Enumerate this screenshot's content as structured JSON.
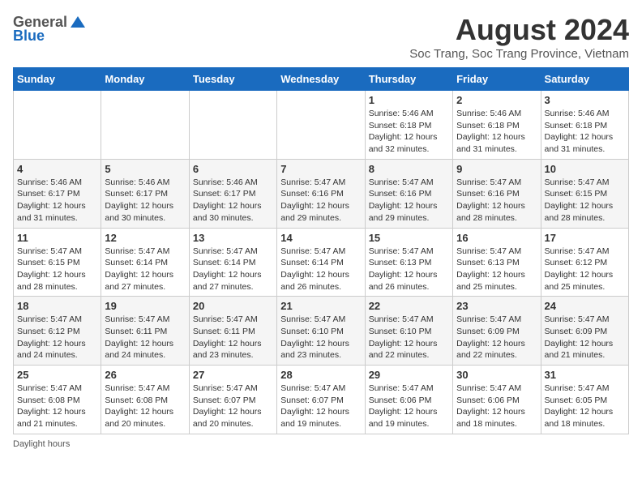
{
  "header": {
    "logo_general": "General",
    "logo_blue": "Blue",
    "title": "August 2024",
    "subtitle": "Soc Trang, Soc Trang Province, Vietnam"
  },
  "days_of_week": [
    "Sunday",
    "Monday",
    "Tuesday",
    "Wednesday",
    "Thursday",
    "Friday",
    "Saturday"
  ],
  "weeks": [
    [
      {
        "day": "",
        "info": ""
      },
      {
        "day": "",
        "info": ""
      },
      {
        "day": "",
        "info": ""
      },
      {
        "day": "",
        "info": ""
      },
      {
        "day": "1",
        "info": "Sunrise: 5:46 AM\nSunset: 6:18 PM\nDaylight: 12 hours and 32 minutes."
      },
      {
        "day": "2",
        "info": "Sunrise: 5:46 AM\nSunset: 6:18 PM\nDaylight: 12 hours and 31 minutes."
      },
      {
        "day": "3",
        "info": "Sunrise: 5:46 AM\nSunset: 6:18 PM\nDaylight: 12 hours and 31 minutes."
      }
    ],
    [
      {
        "day": "4",
        "info": "Sunrise: 5:46 AM\nSunset: 6:17 PM\nDaylight: 12 hours and 31 minutes."
      },
      {
        "day": "5",
        "info": "Sunrise: 5:46 AM\nSunset: 6:17 PM\nDaylight: 12 hours and 30 minutes."
      },
      {
        "day": "6",
        "info": "Sunrise: 5:46 AM\nSunset: 6:17 PM\nDaylight: 12 hours and 30 minutes."
      },
      {
        "day": "7",
        "info": "Sunrise: 5:47 AM\nSunset: 6:16 PM\nDaylight: 12 hours and 29 minutes."
      },
      {
        "day": "8",
        "info": "Sunrise: 5:47 AM\nSunset: 6:16 PM\nDaylight: 12 hours and 29 minutes."
      },
      {
        "day": "9",
        "info": "Sunrise: 5:47 AM\nSunset: 6:16 PM\nDaylight: 12 hours and 28 minutes."
      },
      {
        "day": "10",
        "info": "Sunrise: 5:47 AM\nSunset: 6:15 PM\nDaylight: 12 hours and 28 minutes."
      }
    ],
    [
      {
        "day": "11",
        "info": "Sunrise: 5:47 AM\nSunset: 6:15 PM\nDaylight: 12 hours and 28 minutes."
      },
      {
        "day": "12",
        "info": "Sunrise: 5:47 AM\nSunset: 6:14 PM\nDaylight: 12 hours and 27 minutes."
      },
      {
        "day": "13",
        "info": "Sunrise: 5:47 AM\nSunset: 6:14 PM\nDaylight: 12 hours and 27 minutes."
      },
      {
        "day": "14",
        "info": "Sunrise: 5:47 AM\nSunset: 6:14 PM\nDaylight: 12 hours and 26 minutes."
      },
      {
        "day": "15",
        "info": "Sunrise: 5:47 AM\nSunset: 6:13 PM\nDaylight: 12 hours and 26 minutes."
      },
      {
        "day": "16",
        "info": "Sunrise: 5:47 AM\nSunset: 6:13 PM\nDaylight: 12 hours and 25 minutes."
      },
      {
        "day": "17",
        "info": "Sunrise: 5:47 AM\nSunset: 6:12 PM\nDaylight: 12 hours and 25 minutes."
      }
    ],
    [
      {
        "day": "18",
        "info": "Sunrise: 5:47 AM\nSunset: 6:12 PM\nDaylight: 12 hours and 24 minutes."
      },
      {
        "day": "19",
        "info": "Sunrise: 5:47 AM\nSunset: 6:11 PM\nDaylight: 12 hours and 24 minutes."
      },
      {
        "day": "20",
        "info": "Sunrise: 5:47 AM\nSunset: 6:11 PM\nDaylight: 12 hours and 23 minutes."
      },
      {
        "day": "21",
        "info": "Sunrise: 5:47 AM\nSunset: 6:10 PM\nDaylight: 12 hours and 23 minutes."
      },
      {
        "day": "22",
        "info": "Sunrise: 5:47 AM\nSunset: 6:10 PM\nDaylight: 12 hours and 22 minutes."
      },
      {
        "day": "23",
        "info": "Sunrise: 5:47 AM\nSunset: 6:09 PM\nDaylight: 12 hours and 22 minutes."
      },
      {
        "day": "24",
        "info": "Sunrise: 5:47 AM\nSunset: 6:09 PM\nDaylight: 12 hours and 21 minutes."
      }
    ],
    [
      {
        "day": "25",
        "info": "Sunrise: 5:47 AM\nSunset: 6:08 PM\nDaylight: 12 hours and 21 minutes."
      },
      {
        "day": "26",
        "info": "Sunrise: 5:47 AM\nSunset: 6:08 PM\nDaylight: 12 hours and 20 minutes."
      },
      {
        "day": "27",
        "info": "Sunrise: 5:47 AM\nSunset: 6:07 PM\nDaylight: 12 hours and 20 minutes."
      },
      {
        "day": "28",
        "info": "Sunrise: 5:47 AM\nSunset: 6:07 PM\nDaylight: 12 hours and 19 minutes."
      },
      {
        "day": "29",
        "info": "Sunrise: 5:47 AM\nSunset: 6:06 PM\nDaylight: 12 hours and 19 minutes."
      },
      {
        "day": "30",
        "info": "Sunrise: 5:47 AM\nSunset: 6:06 PM\nDaylight: 12 hours and 18 minutes."
      },
      {
        "day": "31",
        "info": "Sunrise: 5:47 AM\nSunset: 6:05 PM\nDaylight: 12 hours and 18 minutes."
      }
    ]
  ],
  "footer": {
    "note": "Daylight hours"
  }
}
